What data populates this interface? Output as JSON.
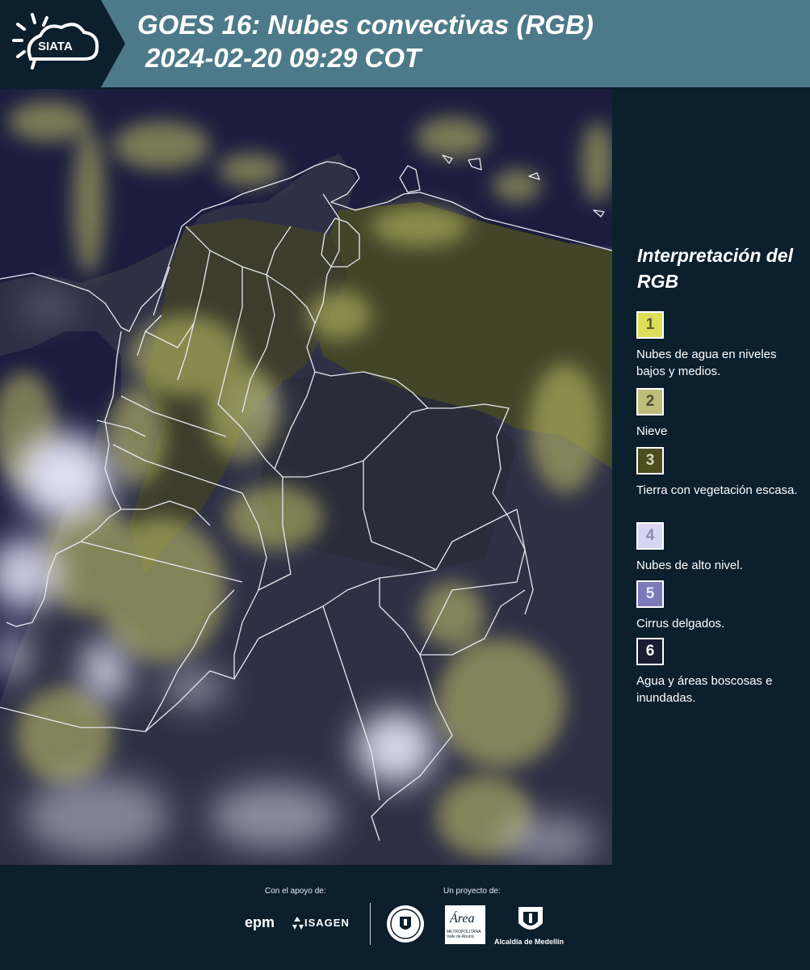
{
  "header": {
    "logo_text": "SIATA",
    "title_line1": "GOES 16: Nubes convectivas (RGB)",
    "title_line2": "2024-02-20 09:29 COT"
  },
  "legend": {
    "title": "Interpretación del RGB",
    "items": [
      {
        "number": "1",
        "color": "#dede5a",
        "text_color": "#5a5a30",
        "label": "Nubes de agua en niveles bajos y medios."
      },
      {
        "number": "2",
        "color": "#bdbd7c",
        "text_color": "#4e4e30",
        "label": "Nieve"
      },
      {
        "number": "3",
        "color": "#4d4d1e",
        "text_color": "#d8d8c0",
        "label": "Tierra con vegetación escasa."
      },
      {
        "number": "4",
        "color": "#d6d6f3",
        "text_color": "#8a8ab0",
        "label": "Nubes de alto nivel."
      },
      {
        "number": "5",
        "color": "#7a7ab9",
        "text_color": "#e8e8ff",
        "label": "Cirrus delgados."
      },
      {
        "number": "6",
        "color": "#1b1b33",
        "text_color": "#ffffff",
        "label": "Agua y áreas boscosas e inundadas."
      }
    ]
  },
  "footer": {
    "support_caption": "Con el apoyo de:",
    "project_caption": "Un proyecto de:",
    "epm_text": "epm",
    "isagen_text": "ISAGEN",
    "area_text": "Área",
    "area_subtext": "METROPOLITANA Valle de Aburrá",
    "alcaldia_text": "Alcaldía de Medellín",
    "seal_text": "MEDELLÍN"
  },
  "colors": {
    "header_bg": "#4d7a89",
    "page_bg": "#0c1f2c",
    "map_water": "#1c1d3e"
  }
}
